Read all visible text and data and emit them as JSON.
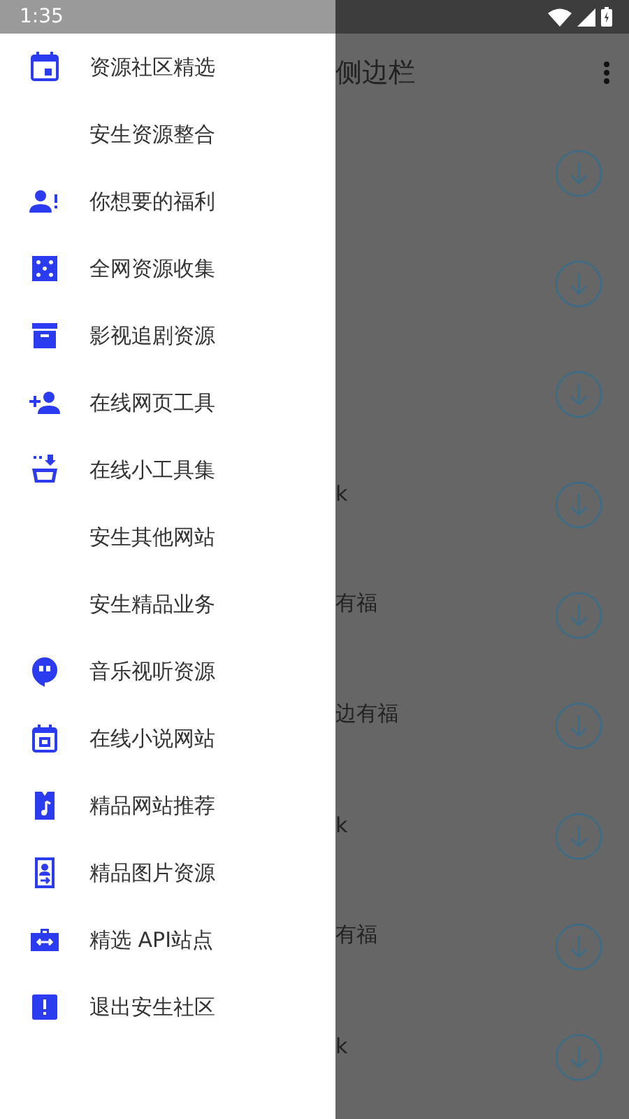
{
  "status_bar": {
    "time": "1:35"
  },
  "app_bar": {
    "title": "侧边栏"
  },
  "list": [
    {
      "kind": "download"
    },
    {
      "kind": "download"
    },
    {
      "kind": "download"
    },
    {
      "text": "k",
      "kind": "download"
    },
    {
      "text": "有福",
      "kind": "download"
    },
    {
      "text": "边有福",
      "kind": "download"
    },
    {
      "text": "k",
      "kind": "download"
    },
    {
      "text": "有福",
      "kind": "download"
    },
    {
      "text": "k",
      "kind": "download"
    }
  ],
  "drawer": {
    "items": [
      {
        "label": "资源社区精选",
        "kind": "icon"
      },
      {
        "label": "安生资源整合",
        "kind": "text"
      },
      {
        "label": "你想要的福利",
        "kind": "icon"
      },
      {
        "label": "全网资源收集",
        "kind": "icon"
      },
      {
        "label": "影视追剧资源",
        "kind": "icon"
      },
      {
        "label": "在线网页工具",
        "kind": "icon"
      },
      {
        "label": "在线小工具集",
        "kind": "icon"
      },
      {
        "label": "安生其他网站",
        "kind": "text"
      },
      {
        "label": "安生精品业务",
        "kind": "text"
      },
      {
        "label": "音乐视听资源",
        "kind": "icon"
      },
      {
        "label": "在线小说网站",
        "kind": "icon"
      },
      {
        "label": "精品网站推荐",
        "kind": "icon"
      },
      {
        "label": "精品图片资源",
        "kind": "icon"
      },
      {
        "label": "精选 API站点",
        "kind": "icon"
      },
      {
        "label": "退出安生社区",
        "kind": "icon"
      }
    ]
  }
}
